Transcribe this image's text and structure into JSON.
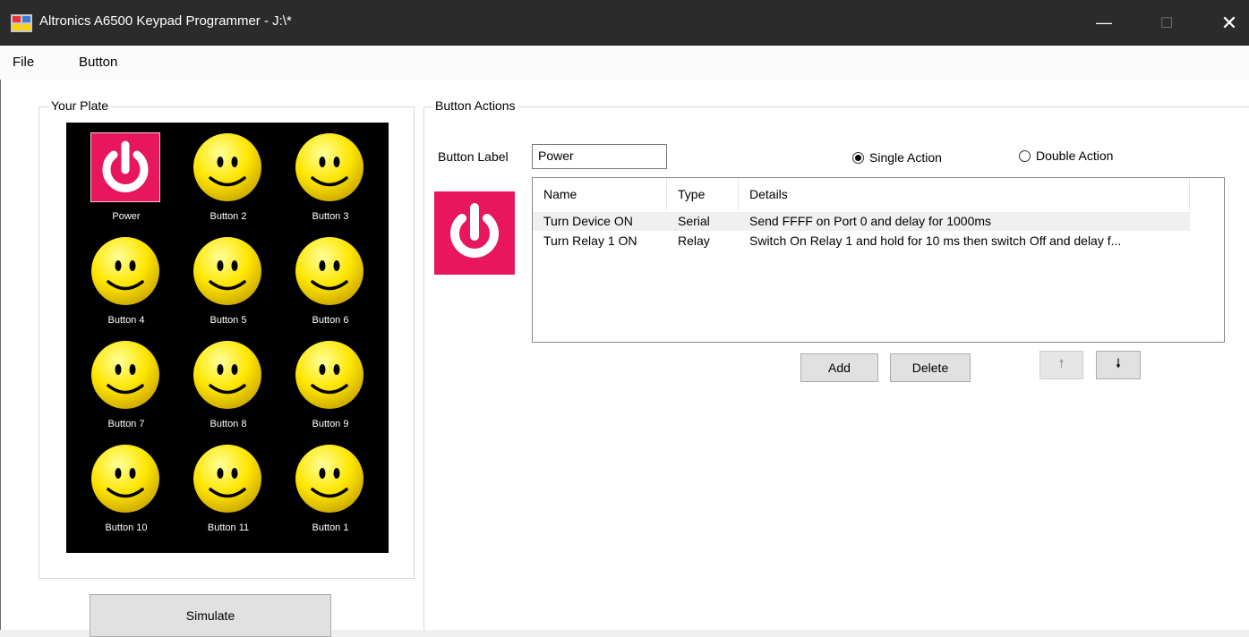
{
  "window": {
    "title": "Altronics A6500 Keypad Programmer - J:\\*",
    "minimize_glyph": "—",
    "maximize_glyph": "☐",
    "close_glyph": "✕"
  },
  "menu": {
    "file": "File",
    "button": "Button"
  },
  "plate": {
    "group_label": "Your Plate",
    "keys": [
      {
        "label": "Power",
        "icon": "power-icon"
      },
      {
        "label": "Button 2",
        "icon": "smiley-icon"
      },
      {
        "label": "Button 3",
        "icon": "smiley-icon"
      },
      {
        "label": "Button 4",
        "icon": "smiley-icon"
      },
      {
        "label": "Button 5",
        "icon": "smiley-icon"
      },
      {
        "label": "Button 6",
        "icon": "smiley-icon"
      },
      {
        "label": "Button 7",
        "icon": "smiley-icon"
      },
      {
        "label": "Button 8",
        "icon": "smiley-icon"
      },
      {
        "label": "Button 9",
        "icon": "smiley-icon"
      },
      {
        "label": "Button 10",
        "icon": "smiley-icon"
      },
      {
        "label": "Button 11",
        "icon": "smiley-icon"
      },
      {
        "label": "Button 1",
        "icon": "smiley-icon"
      }
    ],
    "simulate_label": "Simulate"
  },
  "actions": {
    "group_label": "Button Actions",
    "button_label_caption": "Button Label",
    "button_label_value": "Power",
    "single_action": "Single Action",
    "double_action": "Double Action",
    "selected_mode": "single",
    "columns": [
      "Name",
      "Type",
      "Details"
    ],
    "rows": [
      {
        "name": "Turn Device ON",
        "type": "Serial",
        "details": "Send FFFF on Port 0 and delay for 1000ms"
      },
      {
        "name": "Turn Relay 1 ON",
        "type": "Relay",
        "details": "Switch On Relay 1 and hold for 10 ms then switch Off and delay f..."
      }
    ],
    "add_label": "Add",
    "delete_label": "Delete",
    "up_glyph": "🠕",
    "down_glyph": "🠗"
  },
  "colors": {
    "power_bg": "#e8175d",
    "smiley": "#ffe600",
    "plate_bg": "#000000",
    "titlebar": "#2b2b2b"
  }
}
